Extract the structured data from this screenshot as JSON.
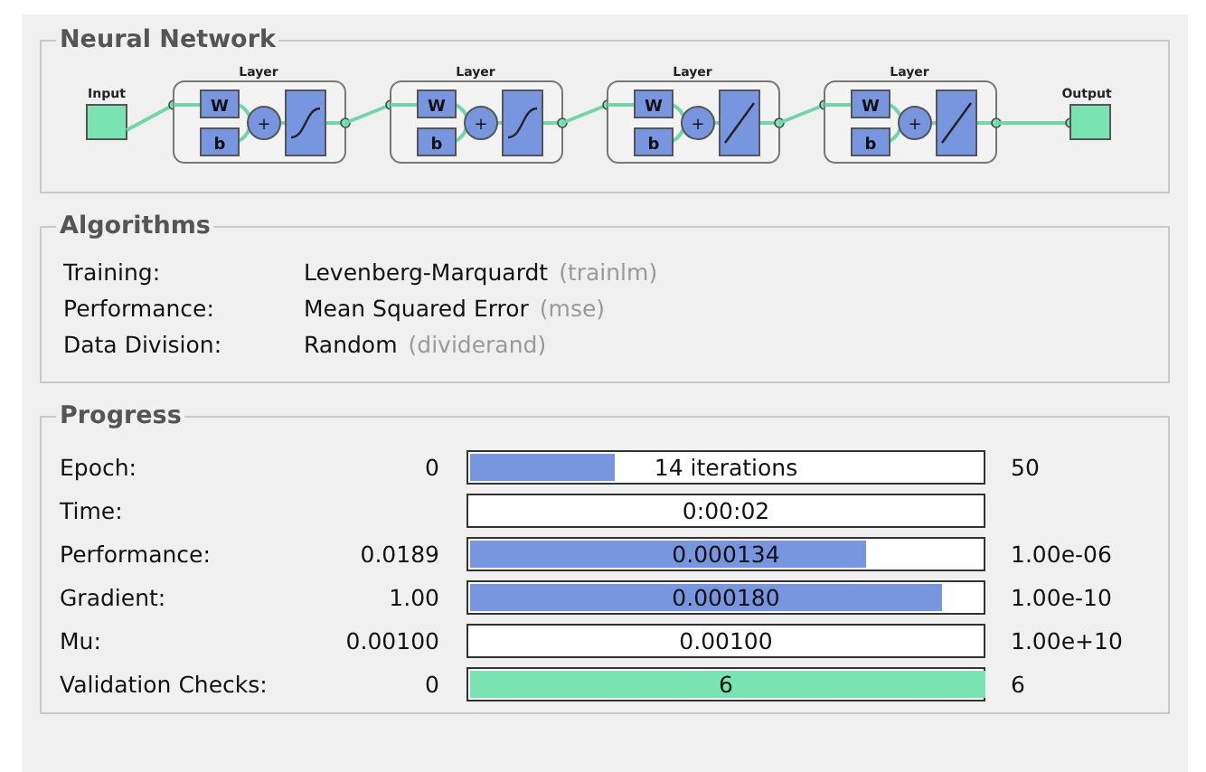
{
  "network": {
    "title": "Neural Network",
    "input_label": "Input",
    "output_label": "Output",
    "layers": [
      {
        "label": "Layer",
        "weight": "W",
        "bias": "b",
        "sum": "+",
        "kind": "sigmoid"
      },
      {
        "label": "Layer",
        "weight": "W",
        "bias": "b",
        "sum": "+",
        "kind": "sigmoid"
      },
      {
        "label": "Layer",
        "weight": "W",
        "bias": "b",
        "sum": "+",
        "kind": "linear"
      },
      {
        "label": "Layer",
        "weight": "W",
        "bias": "b",
        "sum": "+",
        "kind": "linear"
      }
    ]
  },
  "algorithms": {
    "title": "Algorithms",
    "rows": [
      {
        "label": "Training:",
        "value": "Levenberg-Marquardt",
        "function": "(trainlm)"
      },
      {
        "label": "Performance:",
        "value": "Mean Squared Error",
        "function": "(mse)"
      },
      {
        "label": "Data Division:",
        "value": "Random",
        "function": "(dividerand)"
      }
    ]
  },
  "progress": {
    "title": "Progress",
    "rows": [
      {
        "label": "Epoch:",
        "start": "0",
        "bar_text": "14 iterations",
        "level": 0.28,
        "color": "#7895e0",
        "end": "50"
      },
      {
        "label": "Time:",
        "bar_text": "0:00:02"
      },
      {
        "label": "Performance:",
        "start": "0.0189",
        "bar_text": "0.000134",
        "level": 0.77,
        "color": "#7895e0",
        "end": "1.00e-06"
      },
      {
        "label": "Gradient:",
        "start": "1.00",
        "bar_text": "0.000180",
        "level": 0.915,
        "color": "#7895e0",
        "end": "1.00e-10"
      },
      {
        "label": "Mu:",
        "start": "0.00100",
        "bar_text": "0.00100",
        "end": "1.00e+10"
      },
      {
        "label": "Validation Checks:",
        "start": "0",
        "bar_text": "6",
        "level": 1,
        "color": "#7ae3b2",
        "end": "6"
      }
    ]
  }
}
